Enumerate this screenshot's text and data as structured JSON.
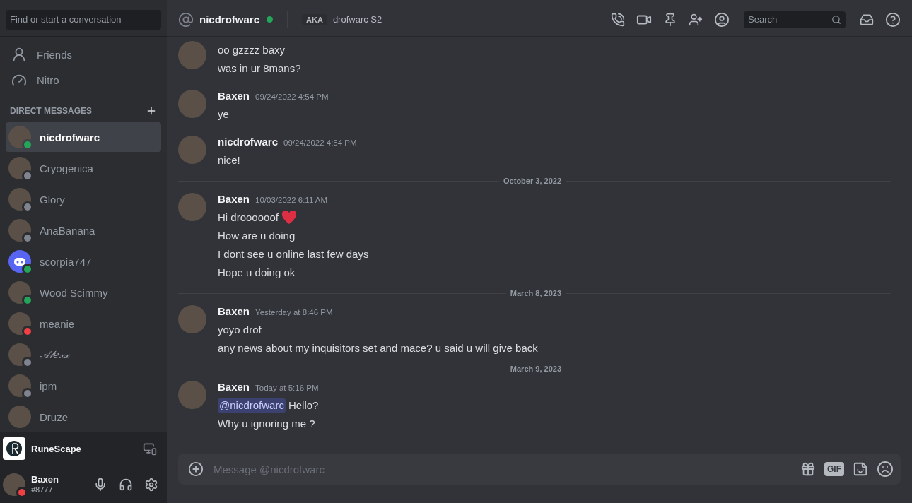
{
  "sidebar": {
    "search": {
      "placeholder": "Find or start a conversation"
    },
    "nav": [
      {
        "kind": "friends",
        "label": "Friends"
      },
      {
        "kind": "nitro",
        "label": "Nitro"
      }
    ],
    "section_title": "DIRECT MESSAGES",
    "dms": [
      {
        "name": "nicdrofwarc",
        "color": "#23a55a",
        "kind": "photo",
        "selected": true
      },
      {
        "name": "Cryogenica",
        "color": "#80848e",
        "kind": "photo",
        "selected": false
      },
      {
        "name": "Glory",
        "color": "#80848e",
        "kind": "photo",
        "selected": false
      },
      {
        "name": "AnaBanana",
        "color": "#80848e",
        "kind": "photo",
        "selected": false
      },
      {
        "name": "scorpia747",
        "color": "#23a55a",
        "kind": "default",
        "selected": false
      },
      {
        "name": "Wood Scimmy",
        "color": "#23a55a",
        "kind": "photo",
        "selected": false
      },
      {
        "name": "meanie",
        "color": "#f23f43",
        "kind": "photo",
        "selected": false
      },
      {
        "name": "𝒜𝓁𝑒𝓍𝓍",
        "color": "#80848e",
        "kind": "photo",
        "selected": false
      },
      {
        "name": "ipm",
        "color": "#80848e",
        "kind": "photo",
        "selected": false
      },
      {
        "name": "Druze",
        "kind": "photo",
        "selected": false
      }
    ],
    "activity": {
      "title": "RuneScape"
    },
    "user": {
      "name": "Baxen",
      "tag": "#8777",
      "color": "#f23f43"
    }
  },
  "header": {
    "name": "nicdrofwarc",
    "color": "#23a55a",
    "aka_label": "AKA",
    "aka": "drofwarc S2",
    "search": {
      "placeholder": "Search"
    }
  },
  "messages": [
    {
      "kind": "group",
      "lines": [
        [
          {
            "kind": "text",
            "text": "oo gzzzz baxy"
          }
        ],
        [
          {
            "kind": "text",
            "text": "was in ur 8mans?"
          }
        ]
      ]
    },
    {
      "kind": "group",
      "author": "Baxen",
      "time": "09/24/2022 4:54 PM",
      "lines": [
        [
          {
            "kind": "text",
            "text": "ye"
          }
        ]
      ]
    },
    {
      "kind": "group",
      "author": "nicdrofwarc",
      "time": "09/24/2022 4:54 PM",
      "lines": [
        [
          {
            "kind": "text",
            "text": "nice!"
          }
        ]
      ]
    },
    {
      "kind": "divider",
      "text": "October 3, 2022"
    },
    {
      "kind": "group",
      "author": "Baxen",
      "time": "10/03/2022 6:11 AM",
      "lines": [
        [
          {
            "kind": "text",
            "text": "Hi droooooof"
          },
          {
            "kind": "heart"
          }
        ],
        [
          {
            "kind": "text",
            "text": "How are u doing"
          }
        ],
        [
          {
            "kind": "text",
            "text": "I dont see u online last few days"
          }
        ],
        [
          {
            "kind": "text",
            "text": "Hope u doing ok"
          }
        ]
      ]
    },
    {
      "kind": "divider",
      "text": "March 8, 2023"
    },
    {
      "kind": "group",
      "author": "Baxen",
      "time": "Yesterday at 8:46 PM",
      "lines": [
        [
          {
            "kind": "text",
            "text": "yoyo drof"
          }
        ],
        [
          {
            "kind": "text",
            "text": "any news about my inquisitors set and mace? u said u will give back"
          }
        ]
      ]
    },
    {
      "kind": "divider",
      "text": "March 9, 2023"
    },
    {
      "kind": "group",
      "author": "Baxen",
      "time": "Today at 5:16 PM",
      "lines": [
        [
          {
            "kind": "mention",
            "text": "@nicdrofwarc"
          },
          {
            "kind": "text",
            "text": "Hello?"
          }
        ],
        [
          {
            "kind": "text",
            "text": "Why u ignoring me ?"
          }
        ]
      ]
    }
  ],
  "composer": {
    "placeholder": "Message @nicdrofwarc",
    "gif_label": "GIF"
  }
}
